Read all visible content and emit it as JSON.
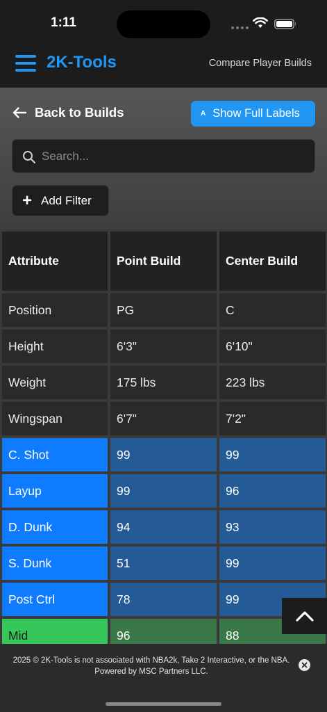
{
  "status": {
    "time": "1:11"
  },
  "header": {
    "brand": "2K-Tools",
    "link": "Compare Player Builds",
    "accent": "#2196f3"
  },
  "controls": {
    "back_label": "Back to Builds",
    "labels_icon": "A",
    "labels_button": "Show Full Labels",
    "search_placeholder": "Search...",
    "search_value": "",
    "add_filter": "Add Filter"
  },
  "table": {
    "headers": [
      "Attribute",
      "Point Build",
      "Center Build"
    ],
    "rows": [
      {
        "label": "Position",
        "point": "PG",
        "center": "C",
        "group": "info"
      },
      {
        "label": "Height",
        "point": "6'3\"",
        "center": "6'10\"",
        "group": "info"
      },
      {
        "label": "Weight",
        "point": "175 lbs",
        "center": "223 lbs",
        "group": "info"
      },
      {
        "label": "Wingspan",
        "point": "6'7\"",
        "center": "7'2\"",
        "group": "info"
      },
      {
        "label": "C. Shot",
        "point": "99",
        "center": "99",
        "group": "finishing"
      },
      {
        "label": "Layup",
        "point": "99",
        "center": "96",
        "group": "finishing"
      },
      {
        "label": "D. Dunk",
        "point": "94",
        "center": "93",
        "group": "finishing"
      },
      {
        "label": "S. Dunk",
        "point": "51",
        "center": "99",
        "group": "finishing"
      },
      {
        "label": "Post Ctrl",
        "point": "78",
        "center": "99",
        "group": "finishing"
      },
      {
        "label": "Mid",
        "point": "96",
        "center": "88",
        "group": "shooting"
      }
    ]
  },
  "footer": {
    "text": "2025 © 2K-Tools is not associated with NBA2k, Take 2 Interactive, or the NBA. Powered by MSC Partners LLC."
  }
}
